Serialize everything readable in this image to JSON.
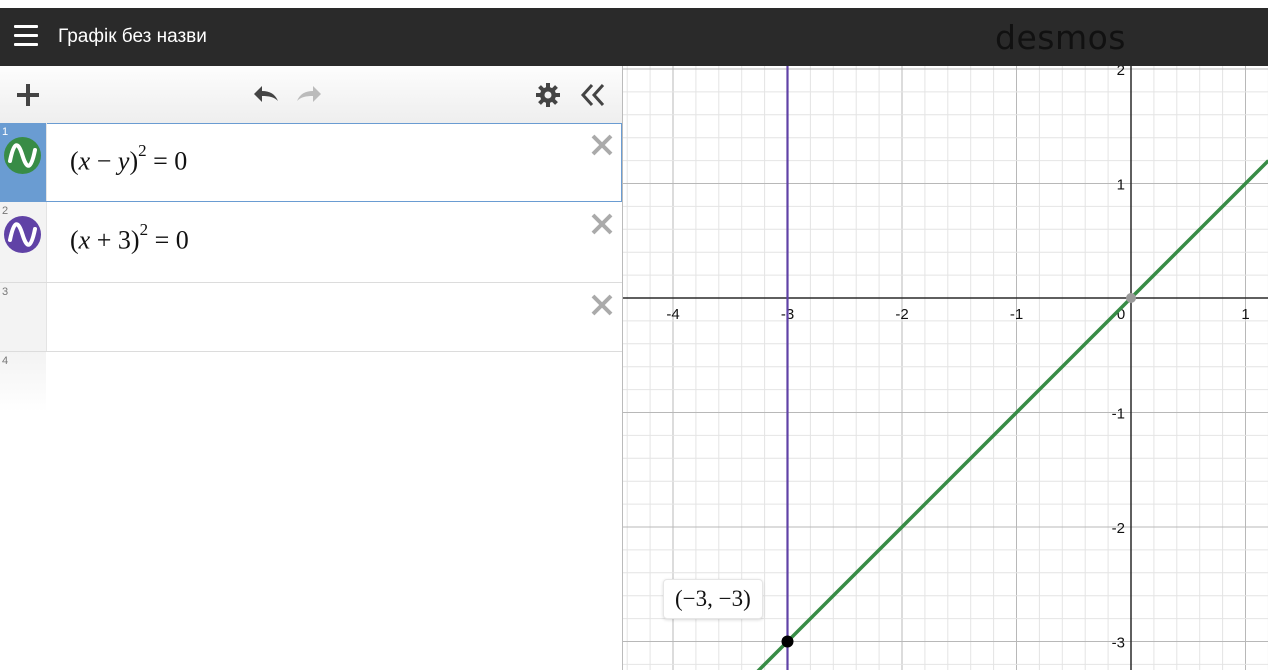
{
  "header": {
    "title": "Графік без назви",
    "logo": "desmos"
  },
  "toolbar": {
    "add_icon": "plus-icon",
    "undo_icon": "undo-icon",
    "redo_icon": "redo-icon",
    "settings_icon": "gear-icon",
    "collapse_icon": "double-chevron-left-icon"
  },
  "expressions": [
    {
      "index": "1",
      "latex": "(x−y)^2=0",
      "parts": {
        "a": "x",
        "op": "−",
        "b": "y",
        "exp": "2",
        "rhs": "= 0"
      },
      "color": "#388c46",
      "selected": true
    },
    {
      "index": "2",
      "latex": "(x+3)^2=0",
      "parts": {
        "a": "x",
        "op": "+",
        "b": "3",
        "exp": "2",
        "rhs": "= 0"
      },
      "color": "#6042a6",
      "selected": false
    },
    {
      "index": "3",
      "latex": "",
      "color": "",
      "selected": false
    },
    {
      "index": "4",
      "latex": "",
      "color": "",
      "selected": false
    }
  ],
  "graph": {
    "x_ticks": [
      "-4",
      "-3",
      "-2",
      "-1",
      "0",
      "1"
    ],
    "y_ticks": [
      "2",
      "1",
      "-1",
      "-2",
      "-3"
    ],
    "point_label": "(−3, −3)",
    "colors": {
      "line1": "#388c46",
      "line2": "#6042a6"
    }
  }
}
